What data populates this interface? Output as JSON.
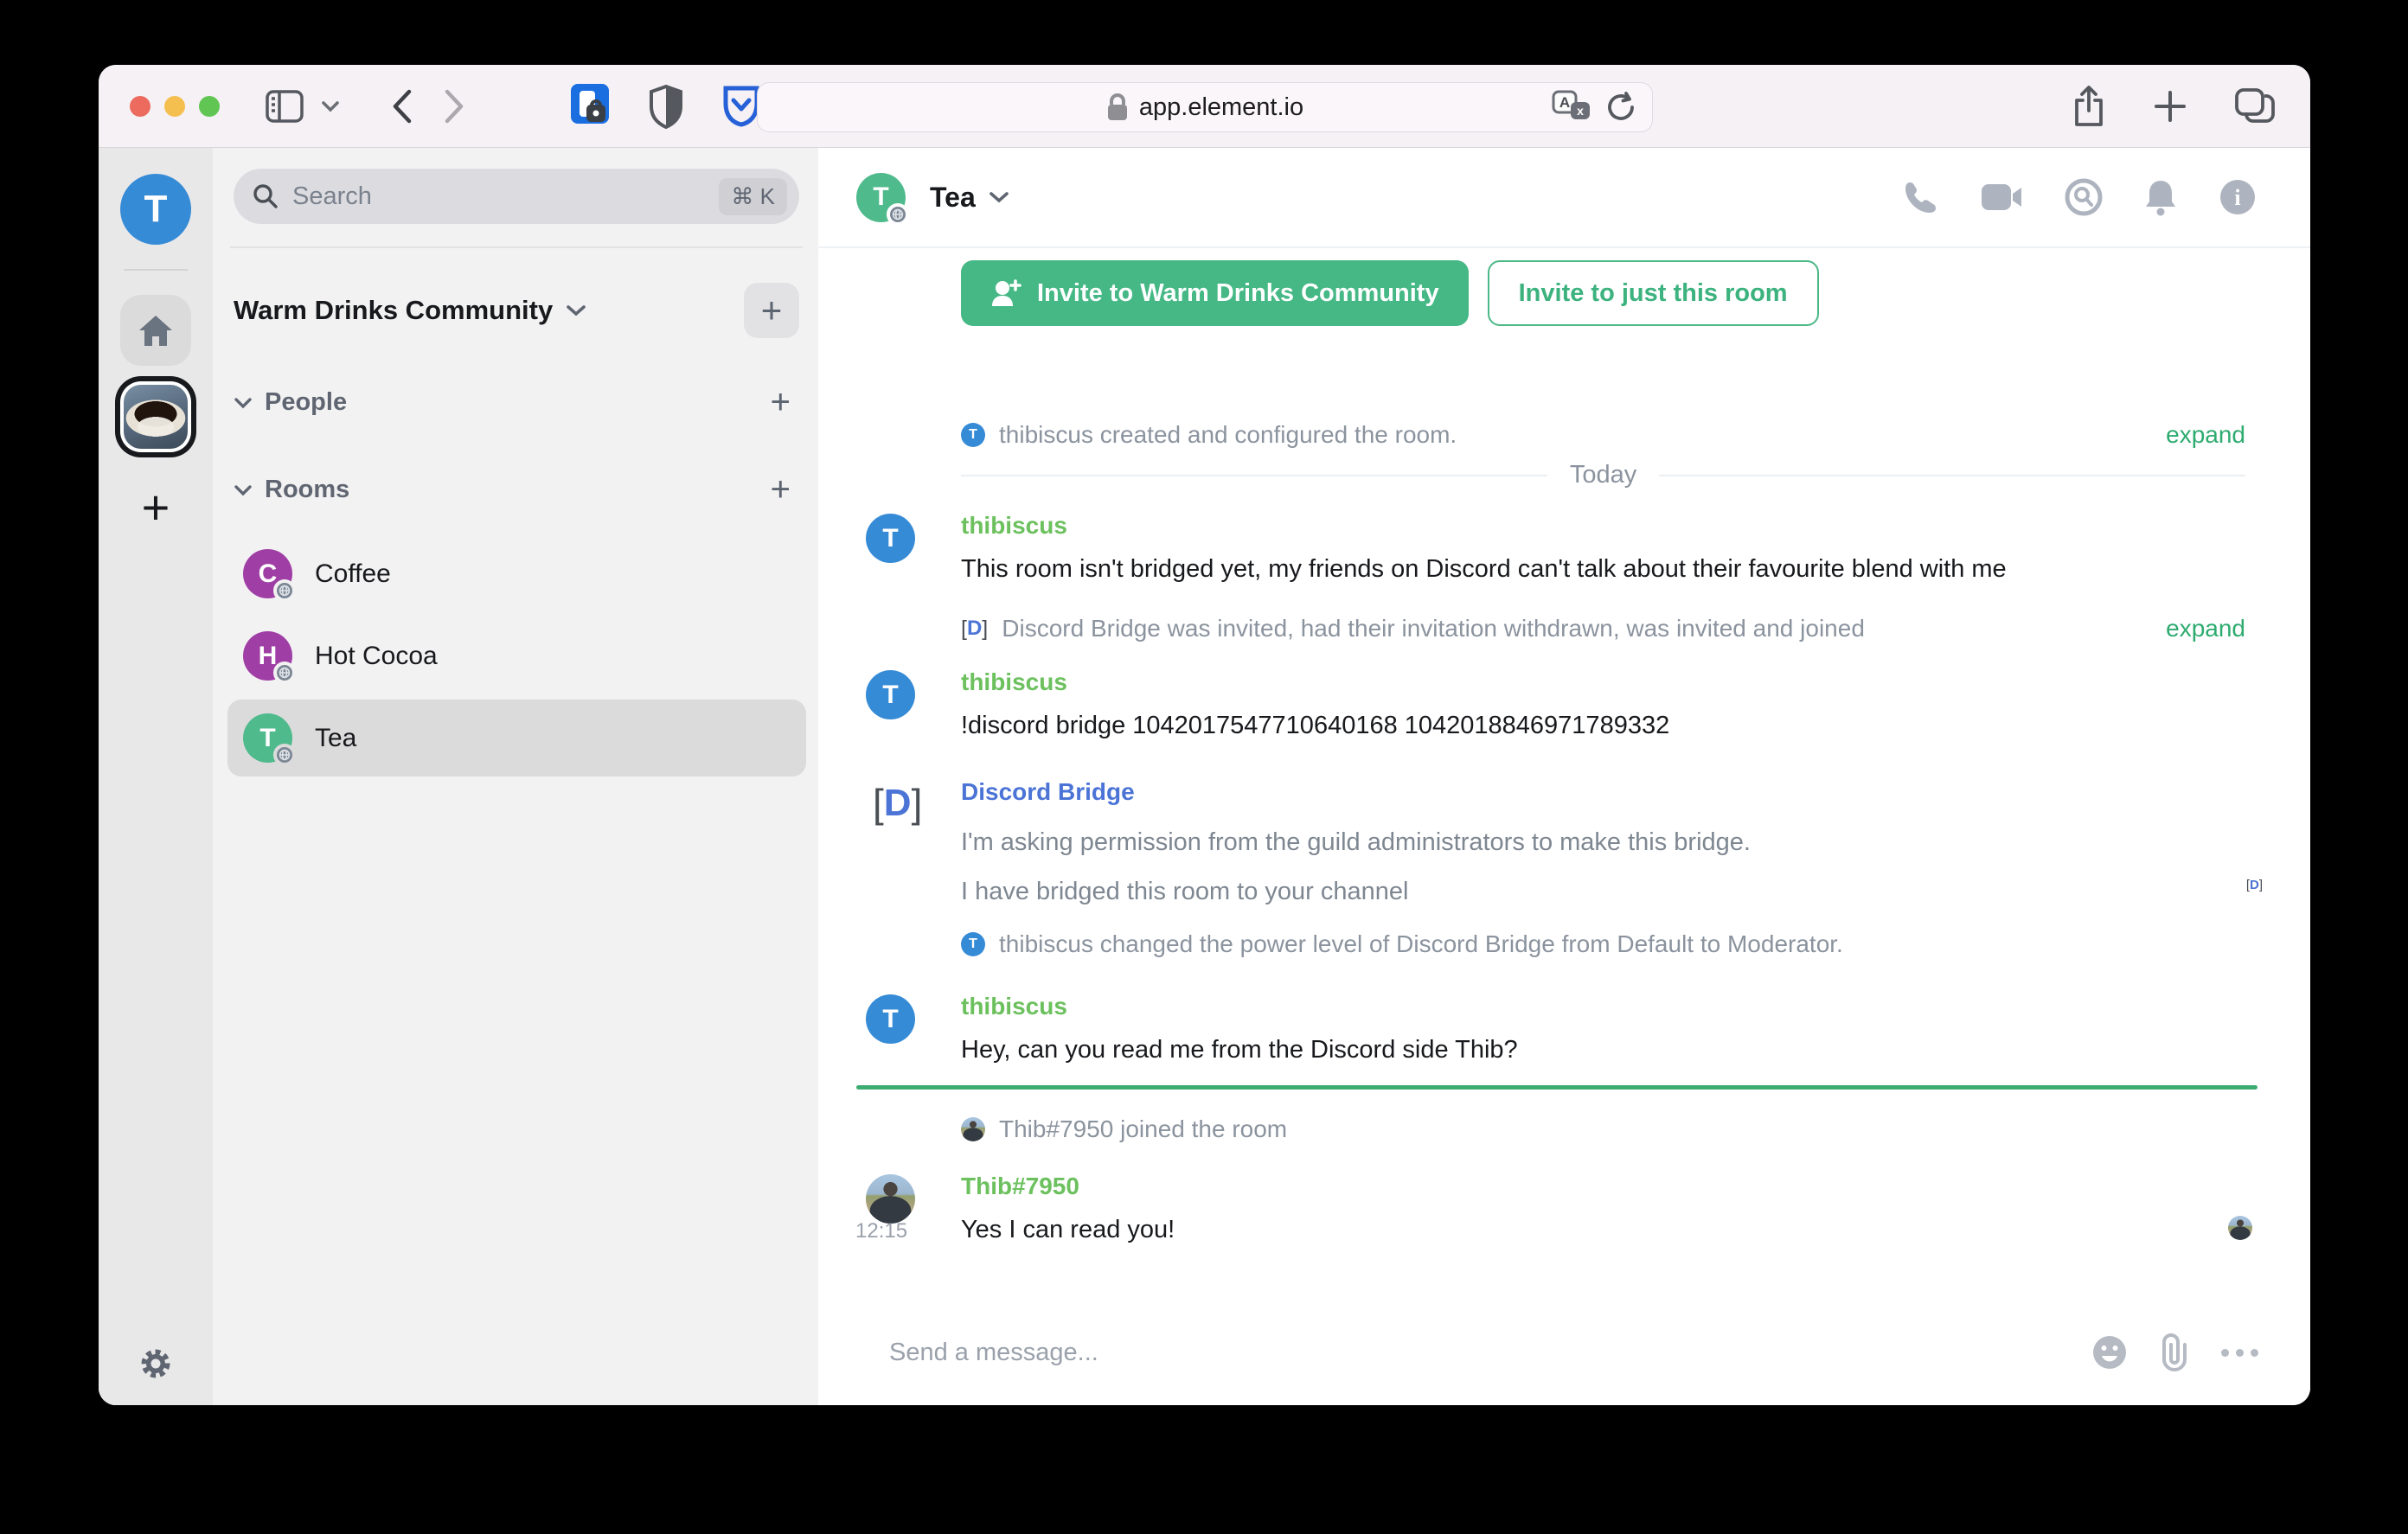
{
  "browser": {
    "url": "app.element.io",
    "traffic_lights": [
      "close",
      "minimize",
      "zoom"
    ]
  },
  "glyphs": {
    "plus": "+",
    "command_k": "⌘ K",
    "info_i": "i",
    "bracket_open": "[",
    "bracket_close": "]",
    "discord_d": "D",
    "translate_a": "A"
  },
  "account": {
    "initial": "T"
  },
  "room_list": {
    "search_placeholder": "Search",
    "search_shortcut": "⌘ K",
    "community_name": "Warm Drinks Community",
    "sections": {
      "people": "People",
      "rooms": "Rooms"
    },
    "rooms": [
      {
        "initial": "C",
        "name": "Coffee",
        "color": "#9f3fa5",
        "selected": false
      },
      {
        "initial": "H",
        "name": "Hot Cocoa",
        "color": "#9f3fa5",
        "selected": false
      },
      {
        "initial": "T",
        "name": "Tea",
        "color": "#4fba8c",
        "selected": true
      }
    ]
  },
  "chat": {
    "room_name": "Tea",
    "room_initial": "T",
    "invite_primary": "Invite to Warm Drinks Community",
    "invite_secondary": "Invite to just this room",
    "expand_label": "expand",
    "timeline": {
      "created_event": "thibiscus created and configured the room.",
      "date_separator": "Today",
      "msg1": {
        "sender": "thibiscus",
        "text": "This room isn't bridged yet, my friends on Discord can't talk about their favourite blend with me"
      },
      "bridge_event": "Discord Bridge was invited, had their invitation withdrawn, was invited and joined",
      "msg2": {
        "sender": "thibiscus",
        "text": "!discord bridge 1042017547710640168 1042018846971789332"
      },
      "bot": {
        "sender": "Discord Bridge",
        "line1": "I'm asking permission from the guild administrators to make this bridge.",
        "line2": "I have bridged this room to your channel"
      },
      "power_event": "thibiscus changed the power level of Discord Bridge from Default to Moderator.",
      "msg3": {
        "sender": "thibiscus",
        "text": "Hey, can you read me from the Discord side Thib?"
      },
      "joined_event": "Thib#7950 joined the room",
      "msg4": {
        "sender": "Thib#7950",
        "time": "12:15",
        "text": "Yes I can read you!"
      }
    },
    "composer_placeholder": "Send a message..."
  },
  "colors": {
    "button_green": "#45b885",
    "link_green": "#2eab70",
    "unread_line_green": "#3dac73",
    "username_green": "#6cc15e",
    "bridge_blue": "#4b74d6",
    "avatar_blue": "#368bd6",
    "avatar_purple": "#9f3fa5",
    "avatar_green": "#4fba8c",
    "muted_text": "#8b939e"
  }
}
